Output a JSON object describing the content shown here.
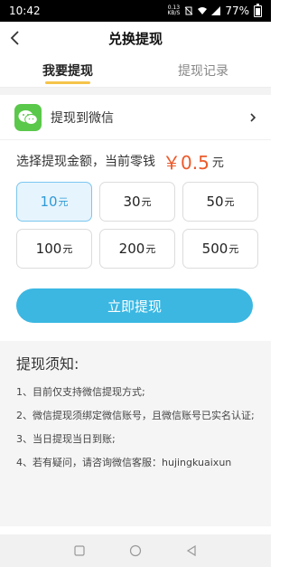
{
  "status_bar": {
    "time": "10:42",
    "net_speed_top": "0.13",
    "net_speed_bottom": "KB/S",
    "battery": "77%"
  },
  "header": {
    "title": "兑换提现"
  },
  "tabs": [
    {
      "label": "我要提现"
    },
    {
      "label": "提现记录"
    }
  ],
  "method": {
    "label": "提现到微信"
  },
  "amount": {
    "prompt": "选择提现金额，当前零钱",
    "balance": "￥0.5",
    "balance_unit": "元",
    "unit": "元",
    "options": [
      "10",
      "30",
      "50",
      "100",
      "200",
      "500"
    ],
    "selected_index": 0
  },
  "submit": {
    "label": "立即提现"
  },
  "notice": {
    "title": "提现须知:",
    "items": [
      "1、目前仅支持微信提现方式;",
      "2、微信提现须绑定微信账号，且微信账号已实名认证;",
      "3、当日提现当日到账;",
      "4、若有疑问，请咨询微信客服：hujingkuaixun"
    ]
  },
  "colors": {
    "accent": "#3bb7e2",
    "tab_indicator": "#f5c44b",
    "balance": "#ec5a2a",
    "wechat": "#5ac84a"
  }
}
